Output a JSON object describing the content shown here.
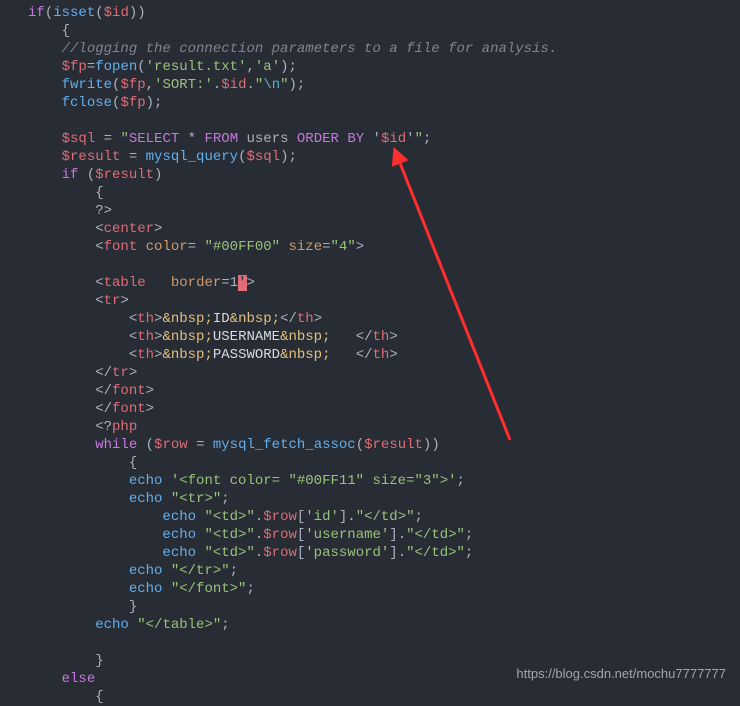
{
  "lines": {
    "l1": {
      "g": "",
      "code": "<span class='kw'>if</span>(<span class='fn'>isset</span>(<span class='var'>$id</span>))"
    },
    "l2": {
      "g": "",
      "code": "    {"
    },
    "l3": {
      "g": "",
      "code": "    <span class='cmt'>//logging the connection parameters to a file for analysis.</span>"
    },
    "l4": {
      "g": "",
      "code": "    <span class='var'>$fp</span><span class='op'>=</span><span class='fn'>fopen</span>(<span class='str'>'result.txt'</span>,<span class='str'>'a'</span>);"
    },
    "l5": {
      "g": "",
      "code": "    <span class='fn'>fwrite</span>(<span class='var'>$fp</span>,<span class='str'>'SORT:'</span>.<span class='var'>$id</span>.<span class='str'>\"</span><span class='esc'>\\n</span><span class='str'>\"</span>);"
    },
    "l6": {
      "g": "",
      "code": "    <span class='fn'>fclose</span>(<span class='var'>$fp</span>);"
    },
    "l7": {
      "g": "",
      "code": ""
    },
    "l8": {
      "g": "",
      "code": "    <span class='var'>$sql</span> <span class='op'>=</span> <span class='str'>\"</span><span class='sqlkw'>SELECT</span> * <span class='sqlkw'>FROM</span> users <span class='sqlkw'>ORDER BY</span> '<span class='var'>$id</span>'<span class='str'>\"</span>;"
    },
    "l9": {
      "g": "",
      "code": "    <span class='var'>$result</span> <span class='op'>=</span> <span class='fn'>mysql_query</span>(<span class='var'>$sql</span>);"
    },
    "l10": {
      "g": "",
      "code": "    <span class='kw'>if</span> (<span class='var'>$result</span>)"
    },
    "l11": {
      "g": "",
      "code": "        {"
    },
    "l12": {
      "g": "",
      "code": "        <span class='op'>?&gt;</span>"
    },
    "l13": {
      "g": "",
      "code": "        &lt;<span class='var'>center</span>&gt;"
    },
    "l14": {
      "g": "",
      "code": "        &lt;<span class='var'>font</span> <span class='attr'>color</span>= <span class='str'>\"#00FF00\"</span> <span class='attr'>size</span>=<span class='str'>\"4\"</span>&gt;"
    },
    "l15": {
      "g": "",
      "code": ""
    },
    "l16": {
      "g": "",
      "code": "        &lt;<span class='var'>table</span>   <span class='attr'>border</span>=1<span class='hl'>'</span>&gt;"
    },
    "l17": {
      "g": "",
      "code": "        &lt;<span class='var'>tr</span>&gt;"
    },
    "l18": {
      "g": "",
      "code": "            &lt;<span class='var'>th</span>&gt;<span class='entity'>&amp;nbsp;</span><span class='white'>ID</span><span class='entity'>&amp;nbsp;</span>&lt;/<span class='var'>th</span>&gt;"
    },
    "l19": {
      "g": "",
      "code": "            &lt;<span class='var'>th</span>&gt;<span class='entity'>&amp;nbsp;</span><span class='white'>USERNAME</span><span class='entity'>&amp;nbsp;</span>   &lt;/<span class='var'>th</span>&gt;"
    },
    "l20": {
      "g": "",
      "code": "            &lt;<span class='var'>th</span>&gt;<span class='entity'>&amp;nbsp;</span><span class='white'>PASSWORD</span><span class='entity'>&amp;nbsp;</span>   &lt;/<span class='var'>th</span>&gt;"
    },
    "l21": {
      "g": "",
      "code": "        &lt;/<span class='var'>tr</span>&gt;"
    },
    "l22": {
      "g": "",
      "code": "        &lt;/<span class='var'>font</span>&gt;"
    },
    "l23": {
      "g": "",
      "code": "        &lt;/<span class='var'>font</span>&gt;"
    },
    "l24": {
      "g": "",
      "code": "        <span class='op'>&lt;?</span><span class='var'>php</span>"
    },
    "l25": {
      "g": "",
      "code": "        <span class='kw'>while</span> (<span class='var'>$row</span> <span class='op'>=</span> <span class='fn'>mysql_fetch_assoc</span>(<span class='var'>$result</span>))"
    },
    "l26": {
      "g": "",
      "code": "            {"
    },
    "l27": {
      "g": "",
      "code": "            <span class='fn'>echo</span> <span class='str'>'&lt;font color= \"#00FF11\" size=\"3\"&gt;'</span>;"
    },
    "l28": {
      "g": "",
      "code": "            <span class='fn'>echo</span> <span class='str'>\"&lt;tr&gt;\"</span>;"
    },
    "l29": {
      "g": "",
      "code": "                <span class='fn'>echo</span> <span class='str'>\"&lt;td&gt;\"</span>.<span class='var'>$row</span>[<span class='str'>'id'</span>].<span class='str'>\"&lt;/td&gt;\"</span>;"
    },
    "l30": {
      "g": "",
      "code": "                <span class='fn'>echo</span> <span class='str'>\"&lt;td&gt;\"</span>.<span class='var'>$row</span>[<span class='str'>'username'</span>].<span class='str'>\"&lt;/td&gt;\"</span>;"
    },
    "l31": {
      "g": "",
      "code": "                <span class='fn'>echo</span> <span class='str'>\"&lt;td&gt;\"</span>.<span class='var'>$row</span>[<span class='str'>'password'</span>].<span class='str'>\"&lt;/td&gt;\"</span>;"
    },
    "l32": {
      "g": "",
      "code": "            <span class='fn'>echo</span> <span class='str'>\"&lt;/tr&gt;\"</span>;"
    },
    "l33": {
      "g": "",
      "code": "            <span class='fn'>echo</span> <span class='str'>\"&lt;/font&gt;\"</span>;"
    },
    "l34": {
      "g": "",
      "code": "            }"
    },
    "l35": {
      "g": "",
      "code": "        <span class='fn'>echo</span> <span class='str'>\"&lt;/table&gt;\"</span>;"
    },
    "l36": {
      "g": "",
      "code": ""
    },
    "l37": {
      "g": "",
      "code": "        }"
    },
    "l38": {
      "g": "",
      "code": "    <span class='kw'>else</span>"
    },
    "l39": {
      "g": "",
      "code": "        {"
    }
  },
  "watermark": "https://blog.csdn.net/mochu7777777"
}
